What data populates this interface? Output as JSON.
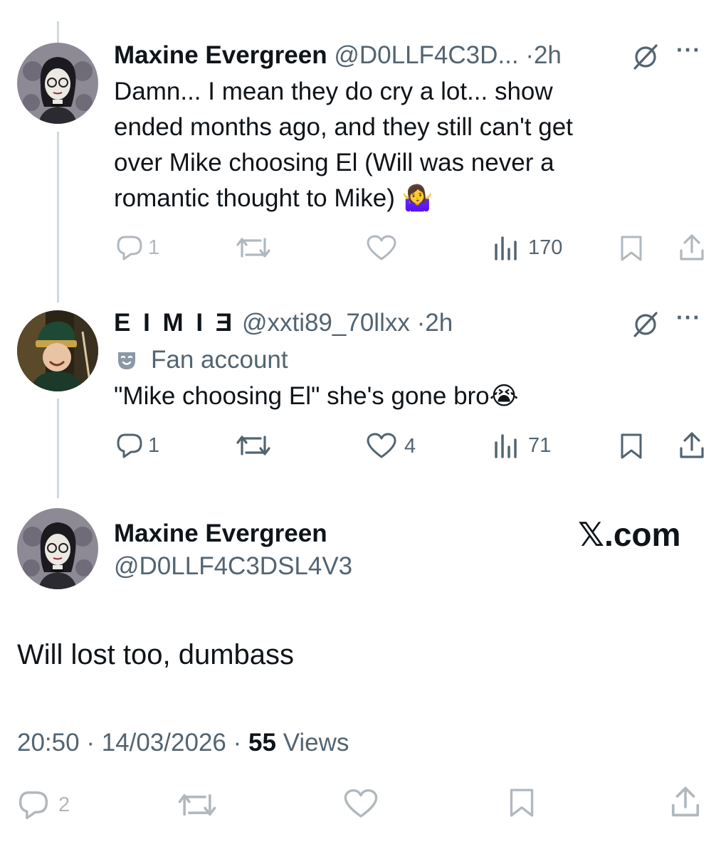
{
  "thread": [
    {
      "author_name": "Maxine Evergreen",
      "handle": "@D0LLF4C3D...",
      "time": "2h",
      "text_lines": [
        "Damn... I mean they do cry a lot... show",
        "ended months ago, and they still can't get",
        "over Mike choosing El (Will was never a",
        "romantic thought to Mike) 🤷‍♀️"
      ],
      "replies": "1",
      "likes": "",
      "views": "170"
    },
    {
      "author_name": "E I M I Ǝ",
      "handle": "@xxti89_70llxx",
      "time": "2h",
      "label": "Fan account",
      "text": "\"Mike choosing El\" she's gone bro😭",
      "replies": "1",
      "likes": "4",
      "views": "71"
    }
  ],
  "main_post": {
    "author_name": "Maxine Evergreen",
    "handle": "@D0LLF4C3DSL4V3",
    "watermark": "𝕏.com",
    "text": "Will lost too, dumbass",
    "time": "20:50",
    "date": "14/03/2026",
    "views_count": "55",
    "views_label": "Views",
    "replies": "2"
  },
  "separator": "·",
  "more_glyph": "···",
  "colors": {
    "text": "#0f1419",
    "muted": "#536471",
    "line": "#cfd9de"
  }
}
